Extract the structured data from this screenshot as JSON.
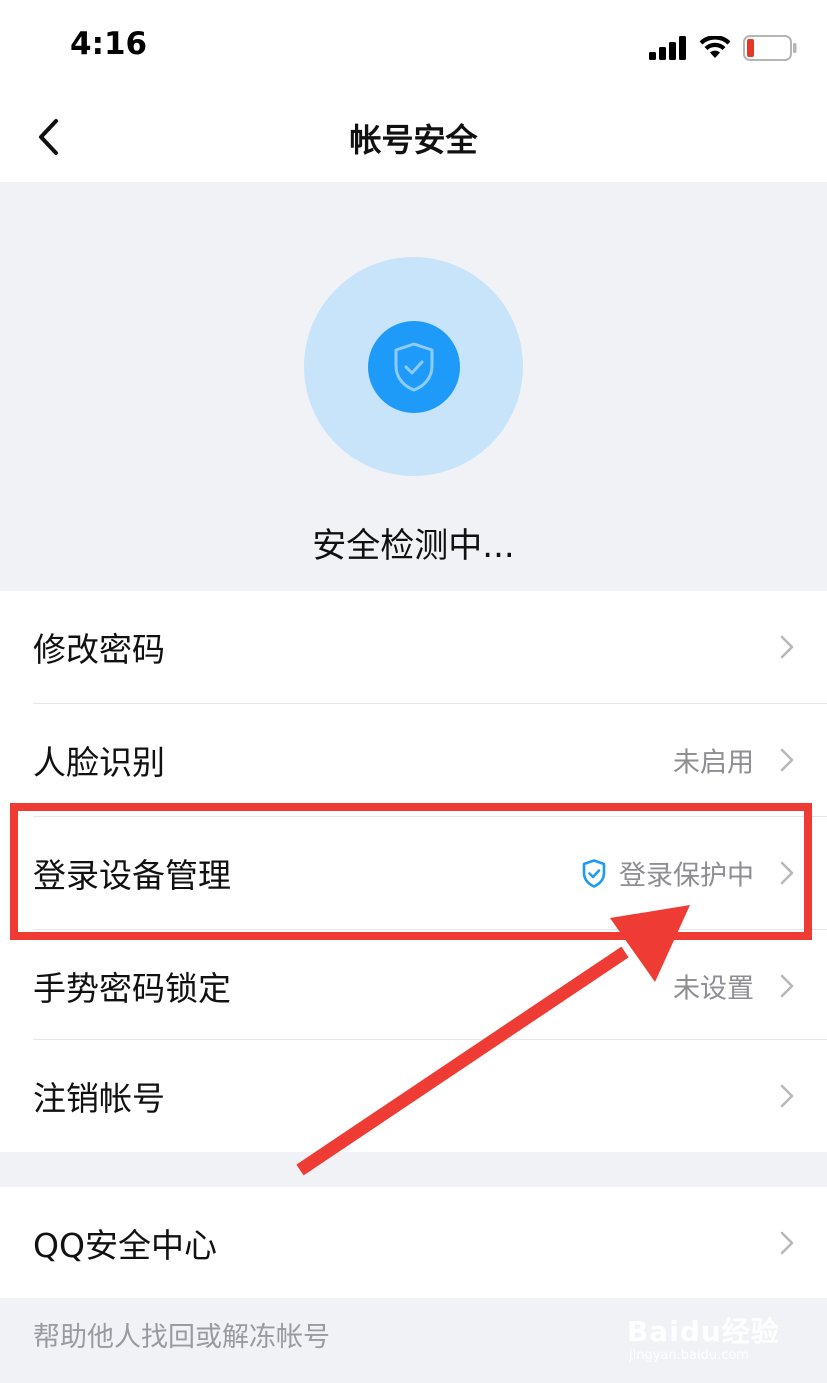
{
  "status_bar": {
    "time": "4:16",
    "battery_color": "#e5362a"
  },
  "nav": {
    "title": "帐号安全",
    "back_icon": "chevron-left-icon"
  },
  "hero": {
    "status_text": "安全检测中...",
    "icon": "shield-check-icon",
    "circle_color": "#c8e4fa",
    "accent_color": "#1e9bf8"
  },
  "menu": {
    "items": [
      {
        "label": "修改密码",
        "value": ""
      },
      {
        "label": "人脸识别",
        "value": "未启用"
      },
      {
        "label": "登录设备管理",
        "value": "登录保护中",
        "value_icon": "shield-check-icon"
      },
      {
        "label": "手势密码锁定",
        "value": "未设置"
      },
      {
        "label": "注销帐号",
        "value": ""
      }
    ]
  },
  "security_center": {
    "label": "QQ安全中心"
  },
  "footer": {
    "help_link": "帮助他人找回或解冻帐号"
  },
  "annotation": {
    "highlight_color": "#ee3c34"
  },
  "watermark": {
    "logo": "Baidu经验",
    "url": "jingyan.baidu.com"
  }
}
